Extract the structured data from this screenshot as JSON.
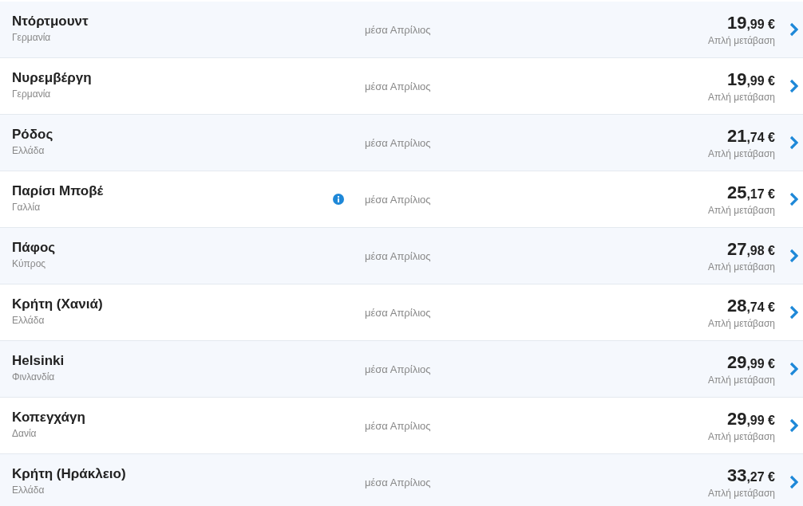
{
  "destinations": [
    {
      "city": "Ντόρτμουντ",
      "country": "Γερμανία",
      "info": false,
      "date": "μέσα Απρίλιος",
      "price_whole": "19",
      "price_decimal": ",99",
      "currency": "€",
      "trip_type": "Απλή μετάβαση"
    },
    {
      "city": "Νυρεμβέργη",
      "country": "Γερμανία",
      "info": false,
      "date": "μέσα Απρίλιος",
      "price_whole": "19",
      "price_decimal": ",99",
      "currency": "€",
      "trip_type": "Απλή μετάβαση"
    },
    {
      "city": "Ρόδος",
      "country": "Ελλάδα",
      "info": false,
      "date": "μέσα Απρίλιος",
      "price_whole": "21",
      "price_decimal": ",74",
      "currency": "€",
      "trip_type": "Απλή μετάβαση"
    },
    {
      "city": "Παρίσι Μποβέ",
      "country": "Γαλλία",
      "info": true,
      "date": "μέσα Απρίλιος",
      "price_whole": "25",
      "price_decimal": ",17",
      "currency": "€",
      "trip_type": "Απλή μετάβαση"
    },
    {
      "city": "Πάφος",
      "country": "Κύπρος",
      "info": false,
      "date": "μέσα Απρίλιος",
      "price_whole": "27",
      "price_decimal": ",98",
      "currency": "€",
      "trip_type": "Απλή μετάβαση"
    },
    {
      "city": "Κρήτη (Χανιά)",
      "country": "Ελλάδα",
      "info": false,
      "date": "μέσα Απρίλιος",
      "price_whole": "28",
      "price_decimal": ",74",
      "currency": "€",
      "trip_type": "Απλή μετάβαση"
    },
    {
      "city": "Helsinki",
      "country": "Φινλανδία",
      "info": false,
      "date": "μέσα Απρίλιος",
      "price_whole": "29",
      "price_decimal": ",99",
      "currency": "€",
      "trip_type": "Απλή μετάβαση"
    },
    {
      "city": "Κοπεγχάγη",
      "country": "Δανία",
      "info": false,
      "date": "μέσα Απρίλιος",
      "price_whole": "29",
      "price_decimal": ",99",
      "currency": "€",
      "trip_type": "Απλή μετάβαση"
    },
    {
      "city": "Κρήτη (Ηράκλειο)",
      "country": "Ελλάδα",
      "info": false,
      "date": "μέσα Απρίλιος",
      "price_whole": "33",
      "price_decimal": ",27",
      "currency": "€",
      "trip_type": "Απλή μετάβαση"
    }
  ]
}
